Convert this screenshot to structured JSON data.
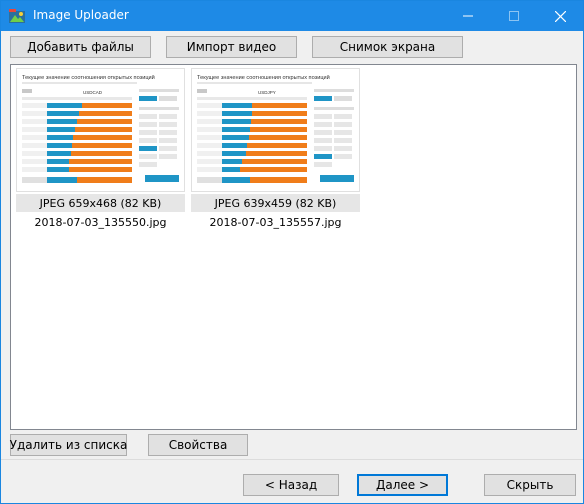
{
  "window": {
    "title": "Image Uploader"
  },
  "colors": {
    "titlebar": "#1e8ae6",
    "accent": "#0078d7",
    "chart_blue": "#1f95c6",
    "chart_orange": "#f07d1a"
  },
  "toolbar": {
    "add_files": "Добавить файлы",
    "import_video": "Импорт видео",
    "screenshot": "Снимок экрана"
  },
  "images": [
    {
      "caption": "JPEG 659x468 (82 KB)",
      "filename": "2018-07-03_135550.jpg",
      "preview_title": "Текущее значение соотношения открытых позиций",
      "preview_pair": "USDCAD"
    },
    {
      "caption": "JPEG 639x459 (82 KB)",
      "filename": "2018-07-03_135557.jpg",
      "preview_title": "Текущее значение соотношения открытых позиций",
      "preview_pair": "USDJPY"
    }
  ],
  "list_actions": {
    "remove": "Удалить из списка",
    "properties": "Свойства"
  },
  "footer": {
    "back": "< Назад",
    "next": "Далее >",
    "hide": "Скрыть"
  }
}
